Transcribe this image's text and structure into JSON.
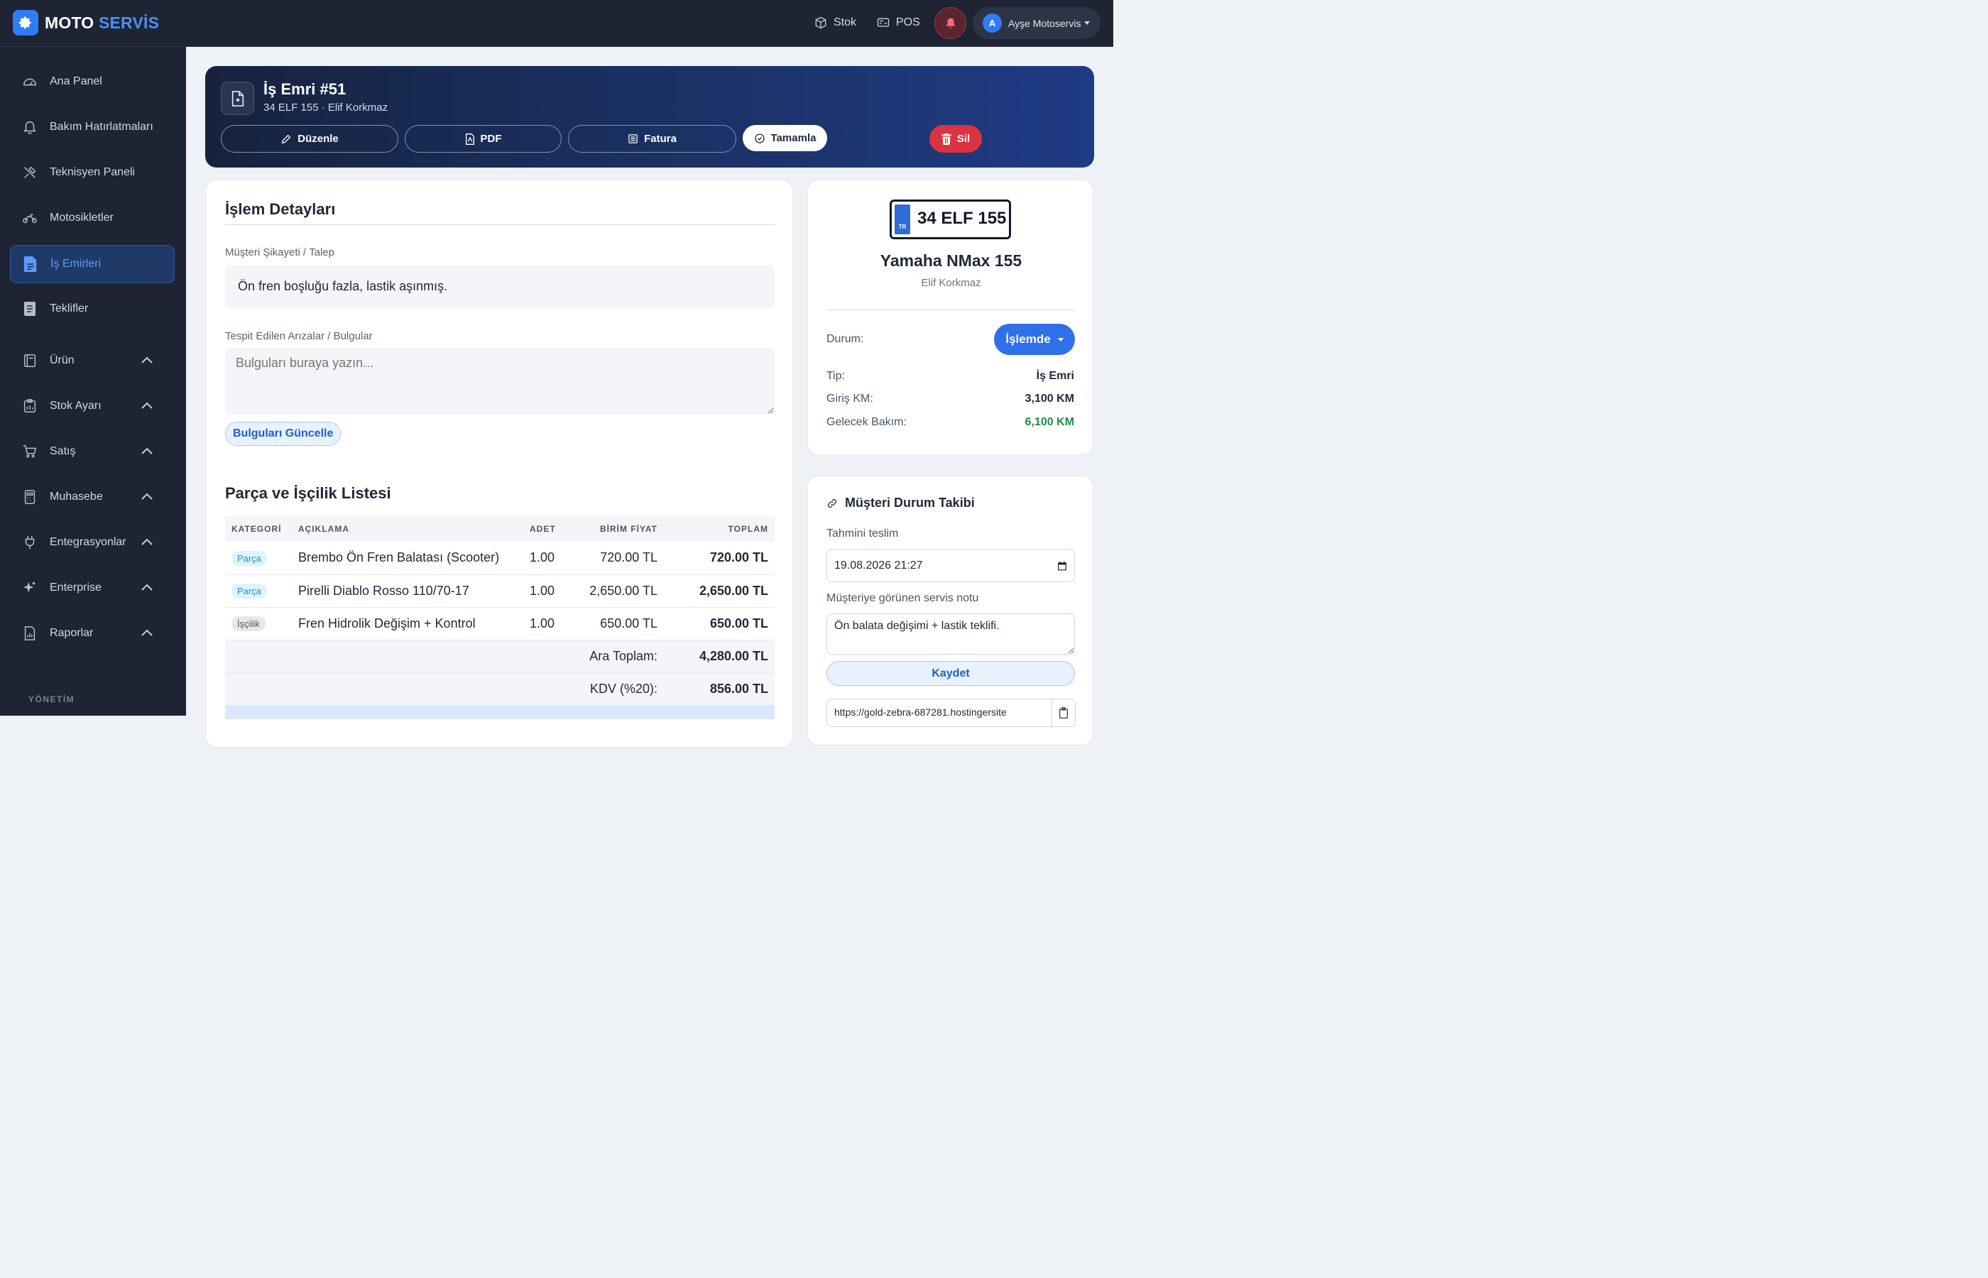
{
  "brand": {
    "name_part1": "MOTO",
    "name_part2": "SERVİS",
    "accent": "#2f7cf6"
  },
  "topnav": {
    "stock_label": "Stok",
    "pos_label": "POS",
    "user_initial": "A",
    "user_name": "Ayşe Motoservis"
  },
  "sidebar": {
    "items": [
      {
        "label": "Ana Panel",
        "icon": "gauge-icon"
      },
      {
        "label": "Bakım Hatırlatmaları",
        "icon": "bell-icon"
      },
      {
        "label": "Teknisyen Paneli",
        "icon": "tools-icon"
      },
      {
        "label": "Motosikletler",
        "icon": "motorcycle-icon"
      },
      {
        "label": "İş Emirleri",
        "icon": "document-icon",
        "active": true
      },
      {
        "label": "Teklifler",
        "icon": "file-text-icon"
      },
      {
        "label": "Ürün",
        "icon": "book-icon"
      },
      {
        "label": "Stok Ayarı",
        "icon": "clipboard-chart-icon"
      },
      {
        "label": "Satış",
        "icon": "cart-icon"
      },
      {
        "label": "Muhasebe",
        "icon": "calculator-icon"
      },
      {
        "label": "Entegrasyonlar",
        "icon": "plug-icon"
      },
      {
        "label": "Enterprise",
        "icon": "sparkles-icon"
      },
      {
        "label": "Raporlar",
        "icon": "report-icon"
      }
    ],
    "section_label": "YÖNETİM"
  },
  "header": {
    "title": "İş Emri #51",
    "subtitle": "34 ELF 155 · Elif Korkmaz",
    "edit_label": "Düzenle",
    "pdf_label": "PDF",
    "invoice_label": "Fatura",
    "complete_label": "Tamamla",
    "delete_label": "Sil"
  },
  "details": {
    "title": "İşlem Detayları",
    "complaint_label": "Müşteri Şikayeti / Talep",
    "complaint_value": "Ön fren boşluğu fazla, lastik aşınmış.",
    "findings_label": "Tespit Edilen Arızalar / Bulgular",
    "findings_placeholder": "Bulguları buraya yazın...",
    "update_button": "Bulguları Güncelle"
  },
  "parts": {
    "title": "Parça ve İşçilik Listesi",
    "columns": [
      "KATEGORİ",
      "AÇIKLAMA",
      "ADET",
      "BİRİM FİYAT",
      "TOPLAM"
    ],
    "rows": [
      {
        "category": "Parça",
        "description": "Brembo Ön Fren Balatası (Scooter)",
        "qty": "1.00",
        "unit_price": "720.00 TL",
        "total": "720.00 TL"
      },
      {
        "category": "Parça",
        "description": "Pirelli Diablo Rosso 110/70-17",
        "qty": "1.00",
        "unit_price": "2,650.00 TL",
        "total": "2,650.00 TL"
      },
      {
        "category": "İşçilik",
        "description": "Fren Hidrolik Değişim + Kontrol",
        "qty": "1.00",
        "unit_price": "650.00 TL",
        "total": "650.00 TL"
      }
    ],
    "subtotal_label": "Ara Toplam:",
    "subtotal_value": "4,280.00 TL",
    "vat_label": "KDV (%20):",
    "vat_value": "856.00 TL"
  },
  "vehicle": {
    "plate_country": "TR",
    "plate": "34 ELF 155",
    "model": "Yamaha NMax 155",
    "owner": "Elif Korkmaz",
    "status_label": "Durum:",
    "status_value": "İşlemde",
    "type_label": "Tip:",
    "type_value": "İş Emri",
    "km_label": "Giriş KM:",
    "km_value": "3,100 KM",
    "next_label": "Gelecek Bakım:",
    "next_value": "6,100 KM"
  },
  "tracking": {
    "title": "Müşteri Durum Takibi",
    "eta_label": "Tahmini teslim",
    "eta_value": "19.08.2026 21:27",
    "note_label": "Müşteriye görünen servis notu",
    "note_value": "Ön balata değişimi + lastik teklifi.",
    "save_label": "Kaydet",
    "link_value": "https://gold-zebra-687281.hostingersite"
  }
}
